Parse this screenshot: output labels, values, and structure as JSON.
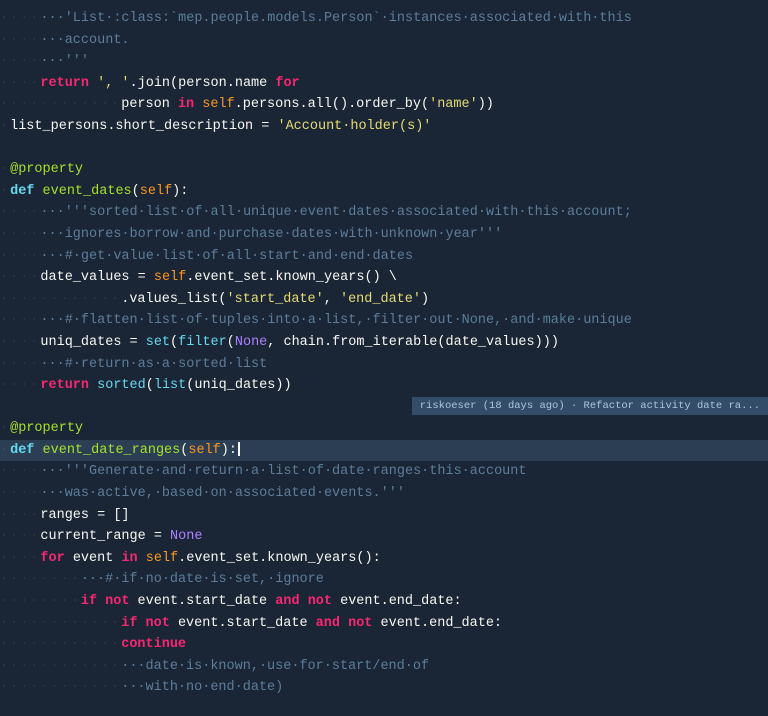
{
  "editor": {
    "background": "#1a2535",
    "lines": [
      {
        "id": 1,
        "indent": "····",
        "tokens": [
          {
            "type": "comment",
            "text": "···'List·:class:`mep.people.models.Person`·instances·associated·with·this"
          }
        ]
      },
      {
        "id": 2,
        "indent": "····",
        "tokens": [
          {
            "type": "comment",
            "text": "···account."
          }
        ]
      },
      {
        "id": 3,
        "indent": "····",
        "tokens": [
          {
            "type": "comment",
            "text": "···'''"
          }
        ]
      },
      {
        "id": 4,
        "indent": "····",
        "tokens": [
          {
            "type": "kw-return",
            "text": "return"
          },
          {
            "type": "plain",
            "text": " "
          },
          {
            "type": "string",
            "text": "', '"
          },
          {
            "type": "plain",
            "text": ".join("
          },
          {
            "type": "variable",
            "text": "person"
          },
          {
            "type": "plain",
            "text": ".name "
          },
          {
            "type": "kw-for",
            "text": "for"
          }
        ]
      },
      {
        "id": 5,
        "indent": "············",
        "tokens": [
          {
            "type": "variable",
            "text": "person"
          },
          {
            "type": "plain",
            "text": " "
          },
          {
            "type": "kw-in",
            "text": "in"
          },
          {
            "type": "plain",
            "text": " "
          },
          {
            "type": "self-kw",
            "text": "self"
          },
          {
            "type": "plain",
            "text": ".persons.all().order_by("
          },
          {
            "type": "string",
            "text": "'name'"
          },
          {
            "type": "plain",
            "text": "))"
          }
        ]
      },
      {
        "id": 6,
        "indent": "·",
        "tokens": [
          {
            "type": "variable",
            "text": "list_persons"
          },
          {
            "type": "plain",
            "text": ".short_description = "
          },
          {
            "type": "string",
            "text": "'Account·holder(s)'"
          }
        ]
      },
      {
        "id": 7,
        "indent": "",
        "tokens": []
      },
      {
        "id": 8,
        "indent": "·",
        "tokens": [
          {
            "type": "decorator",
            "text": "@property"
          }
        ]
      },
      {
        "id": 9,
        "indent": "·",
        "tokens": [
          {
            "type": "kw-def",
            "text": "def"
          },
          {
            "type": "plain",
            "text": " "
          },
          {
            "type": "func-name",
            "text": "event_dates"
          },
          {
            "type": "plain",
            "text": "("
          },
          {
            "type": "self-kw",
            "text": "self"
          },
          {
            "type": "plain",
            "text": "):"
          }
        ]
      },
      {
        "id": 10,
        "indent": "····",
        "tokens": [
          {
            "type": "comment",
            "text": "···'''sorted·list·of·all·unique·event·dates·associated·with·this·account;"
          }
        ]
      },
      {
        "id": 11,
        "indent": "····",
        "tokens": [
          {
            "type": "comment",
            "text": "···ignores·borrow·and·purchase·dates·with·unknown·year'''"
          }
        ]
      },
      {
        "id": 12,
        "indent": "····",
        "tokens": [
          {
            "type": "comment",
            "text": "···#·get·value·list·of·all·start·and·end·dates"
          }
        ]
      },
      {
        "id": 13,
        "indent": "····",
        "tokens": [
          {
            "type": "variable",
            "text": "date_values"
          },
          {
            "type": "plain",
            "text": " = "
          },
          {
            "type": "self-kw",
            "text": "self"
          },
          {
            "type": "plain",
            "text": ".event_set.known_years() \\"
          }
        ]
      },
      {
        "id": 14,
        "indent": "············",
        "tokens": [
          {
            "type": "plain",
            "text": ".values_list("
          },
          {
            "type": "string",
            "text": "'start_date'"
          },
          {
            "type": "plain",
            "text": ", "
          },
          {
            "type": "string",
            "text": "'end_date'"
          },
          {
            "type": "plain",
            "text": ")"
          }
        ]
      },
      {
        "id": 15,
        "indent": "····",
        "tokens": [
          {
            "type": "comment",
            "text": "···#·flatten·list·of·tuples·into·a·list,·filter·out·None,·and·make·unique"
          }
        ]
      },
      {
        "id": 16,
        "indent": "····",
        "tokens": [
          {
            "type": "variable",
            "text": "uniq_dates"
          },
          {
            "type": "plain",
            "text": " = "
          },
          {
            "type": "builtin",
            "text": "set"
          },
          {
            "type": "plain",
            "text": "("
          },
          {
            "type": "builtin",
            "text": "filter"
          },
          {
            "type": "plain",
            "text": "("
          },
          {
            "type": "none-kw",
            "text": "None"
          },
          {
            "type": "plain",
            "text": ", chain.from_iterable(date_values)))"
          }
        ]
      },
      {
        "id": 17,
        "indent": "····",
        "tokens": [
          {
            "type": "comment",
            "text": "···#·return·as·a·sorted·list"
          }
        ]
      },
      {
        "id": 18,
        "indent": "····",
        "tokens": [
          {
            "type": "kw-return",
            "text": "return"
          },
          {
            "type": "plain",
            "text": " "
          },
          {
            "type": "builtin",
            "text": "sorted"
          },
          {
            "type": "plain",
            "text": "("
          },
          {
            "type": "builtin",
            "text": "list"
          },
          {
            "type": "plain",
            "text": "(uniq_dates))"
          }
        ]
      },
      {
        "id": 19,
        "indent": "",
        "tokens": [],
        "blame": "riskoeser (18 days ago) · Refactor activity date ra..."
      },
      {
        "id": 20,
        "indent": "·",
        "tokens": [
          {
            "type": "decorator",
            "text": "@property"
          }
        ]
      },
      {
        "id": 21,
        "indent": "·",
        "tokens": [
          {
            "type": "kw-def",
            "text": "def"
          },
          {
            "type": "plain",
            "text": " "
          },
          {
            "type": "func-name",
            "text": "event_date_ranges"
          },
          {
            "type": "plain",
            "text": "("
          },
          {
            "type": "self-kw",
            "text": "self"
          },
          {
            "type": "plain",
            "text": "):"
          },
          {
            "type": "cursor",
            "text": ""
          }
        ],
        "active": true
      },
      {
        "id": 22,
        "indent": "····",
        "tokens": [
          {
            "type": "comment",
            "text": "···'''Generate·and·return·a·list·of·date·ranges·this·account"
          }
        ]
      },
      {
        "id": 23,
        "indent": "····",
        "tokens": [
          {
            "type": "comment",
            "text": "···was·active,·based·on·associated·events.'''"
          }
        ]
      },
      {
        "id": 24,
        "indent": "····",
        "tokens": [
          {
            "type": "variable",
            "text": "ranges"
          },
          {
            "type": "plain",
            "text": " = []"
          }
        ]
      },
      {
        "id": 25,
        "indent": "····",
        "tokens": [
          {
            "type": "variable",
            "text": "current_range"
          },
          {
            "type": "plain",
            "text": " = "
          },
          {
            "type": "none-kw",
            "text": "None"
          }
        ]
      },
      {
        "id": 26,
        "indent": "····",
        "tokens": [
          {
            "type": "kw-for",
            "text": "for"
          },
          {
            "type": "plain",
            "text": " event "
          },
          {
            "type": "kw-in",
            "text": "in"
          },
          {
            "type": "plain",
            "text": " "
          },
          {
            "type": "self-kw",
            "text": "self"
          },
          {
            "type": "plain",
            "text": ".event_set.known_years():"
          }
        ]
      },
      {
        "id": 27,
        "indent": "········",
        "tokens": [
          {
            "type": "comment",
            "text": "···#·if·no·date·is·set,·ignore"
          }
        ]
      },
      {
        "id": 28,
        "indent": "········",
        "tokens": [
          {
            "type": "kw-if",
            "text": "if"
          },
          {
            "type": "plain",
            "text": " "
          },
          {
            "type": "kw-not",
            "text": "not"
          },
          {
            "type": "plain",
            "text": " event.start_date "
          },
          {
            "type": "kw-and",
            "text": "and"
          },
          {
            "type": "plain",
            "text": " "
          },
          {
            "type": "kw-not",
            "text": "not"
          },
          {
            "type": "plain",
            "text": " event.end_date:"
          }
        ]
      },
      {
        "id": 29,
        "indent": "············",
        "tokens": [
          {
            "type": "kw-if",
            "text": "if"
          },
          {
            "type": "plain",
            "text": " "
          },
          {
            "type": "kw-not",
            "text": "not"
          },
          {
            "type": "plain",
            "text": " event.start_date "
          },
          {
            "type": "kw-and",
            "text": "and"
          },
          {
            "type": "plain",
            "text": " "
          },
          {
            "type": "kw-not",
            "text": "not"
          },
          {
            "type": "plain",
            "text": " event.end_date:"
          }
        ]
      },
      {
        "id": 30,
        "indent": "············",
        "tokens": [
          {
            "type": "kw-continue",
            "text": "continue"
          }
        ]
      },
      {
        "id": 31,
        "indent": "············",
        "tokens": [
          {
            "type": "comment",
            "text": "···date·is·known,·use·for·start/end·of"
          }
        ]
      },
      {
        "id": 32,
        "indent": "············",
        "tokens": [
          {
            "type": "comment",
            "text": "···with·no·end·date)"
          }
        ]
      }
    ]
  }
}
